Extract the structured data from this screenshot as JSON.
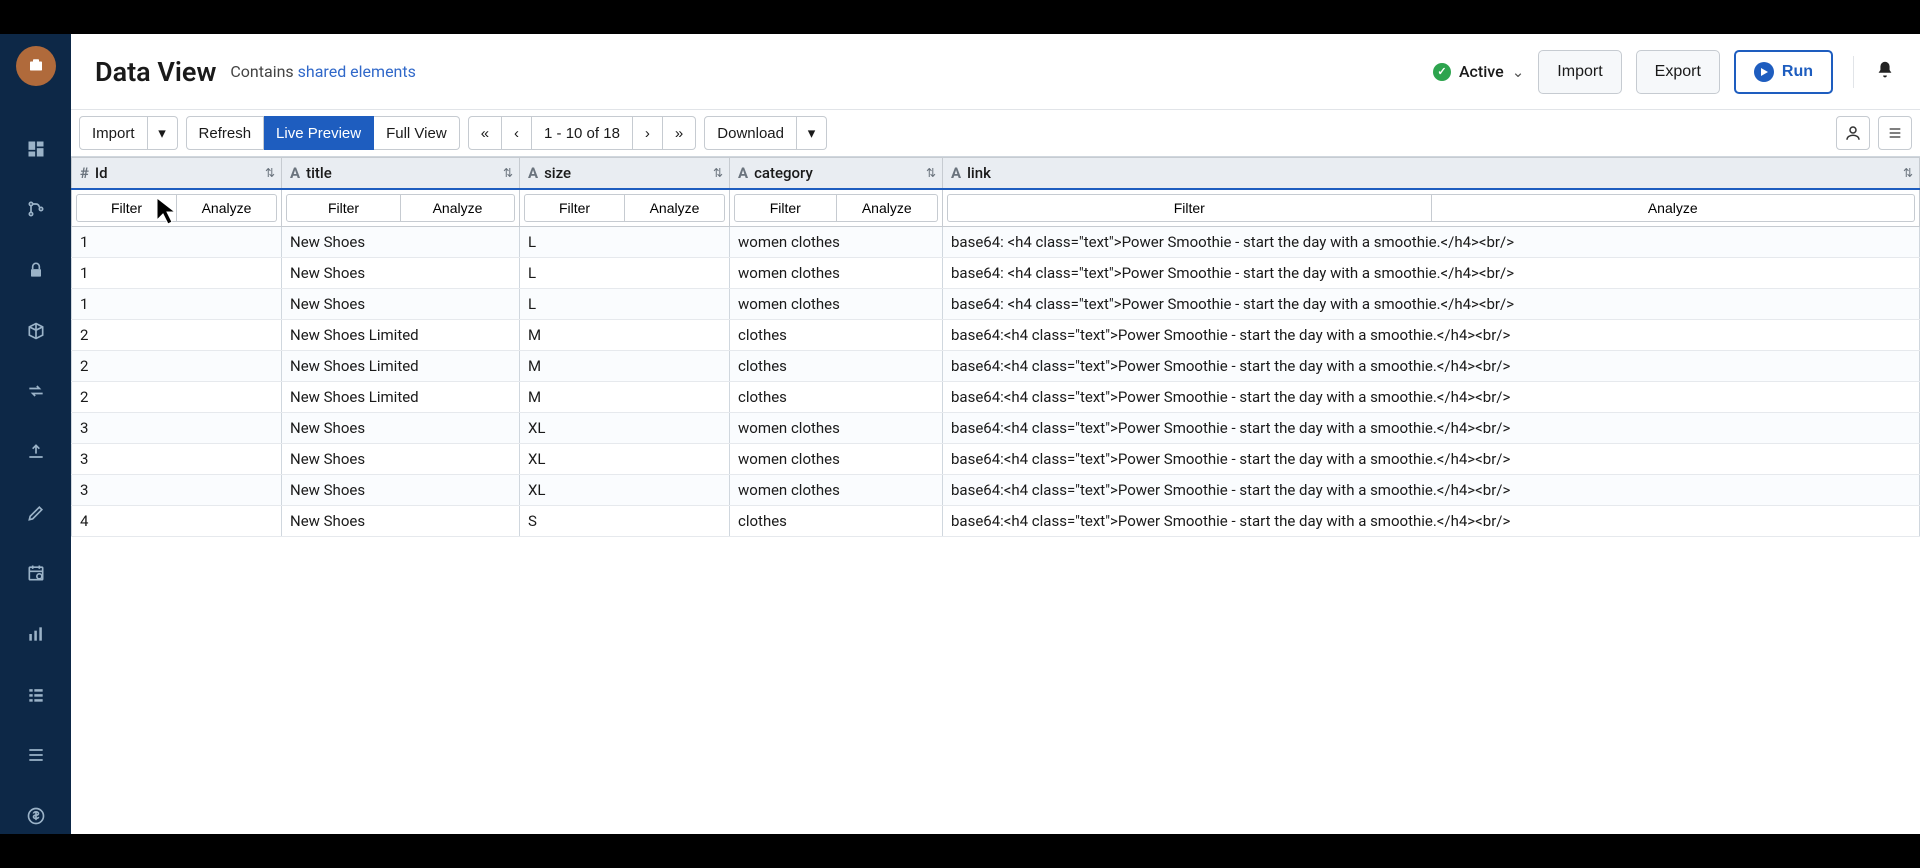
{
  "header": {
    "title": "Data View",
    "subtitle_prefix": "Contains ",
    "subtitle_link": "shared elements",
    "status_text": "Active",
    "import_btn": "Import",
    "export_btn": "Export",
    "run_btn": "Run"
  },
  "toolbar": {
    "import": "Import",
    "refresh": "Refresh",
    "live_preview": "Live Preview",
    "full_view": "Full View",
    "page_first": "«",
    "page_prev": "‹",
    "page_info": "1 - 10 of 18",
    "page_next": "›",
    "page_last": "»",
    "download": "Download"
  },
  "columns": [
    {
      "type": "#",
      "label": "Id"
    },
    {
      "type": "A",
      "label": "title"
    },
    {
      "type": "A",
      "label": "size"
    },
    {
      "type": "A",
      "label": "category"
    },
    {
      "type": "A",
      "label": "link"
    }
  ],
  "filter_label": "Filter",
  "analyze_label": "Analyze",
  "rows": [
    {
      "id": "1",
      "title": "New Shoes",
      "size": "L",
      "category": "women clothes",
      "link": "base64: <h4 class=\"text\">Power Smoothie - start the day with a smoothie.</h4><br/>"
    },
    {
      "id": "1",
      "title": "New Shoes",
      "size": "L",
      "category": "women clothes",
      "link": "base64: <h4 class=\"text\">Power Smoothie - start the day with a smoothie.</h4><br/>"
    },
    {
      "id": "1",
      "title": "New Shoes",
      "size": "L",
      "category": "women clothes",
      "link": "base64: <h4 class=\"text\">Power Smoothie - start the day with a smoothie.</h4><br/>"
    },
    {
      "id": "2",
      "title": "New Shoes Limited",
      "size": "M",
      "category": "clothes",
      "link": "base64:<h4 class=\"text\">Power Smoothie - start the day with a smoothie.</h4><br/>"
    },
    {
      "id": "2",
      "title": "New Shoes Limited",
      "size": "M",
      "category": "clothes",
      "link": "base64:<h4 class=\"text\">Power Smoothie - start the day with a smoothie.</h4><br/>"
    },
    {
      "id": "2",
      "title": "New Shoes Limited",
      "size": "M",
      "category": "clothes",
      "link": "base64:<h4 class=\"text\">Power Smoothie - start the day with a smoothie.</h4><br/>"
    },
    {
      "id": "3",
      "title": "New Shoes",
      "size": "XL",
      "category": "women clothes",
      "link": "base64:<h4 class=\"text\">Power Smoothie - start the day with a smoothie.</h4><br/>"
    },
    {
      "id": "3",
      "title": "New Shoes",
      "size": "XL",
      "category": "women clothes",
      "link": "base64:<h4 class=\"text\">Power Smoothie - start the day with a smoothie.</h4><br/>"
    },
    {
      "id": "3",
      "title": "New Shoes",
      "size": "XL",
      "category": "women clothes",
      "link": "base64:<h4 class=\"text\">Power Smoothie - start the day with a smoothie.</h4><br/>"
    },
    {
      "id": "4",
      "title": "New Shoes",
      "size": "S",
      "category": "clothes",
      "link": "base64:<h4 class=\"text\">Power Smoothie - start the day with a smoothie.</h4><br/>"
    }
  ]
}
